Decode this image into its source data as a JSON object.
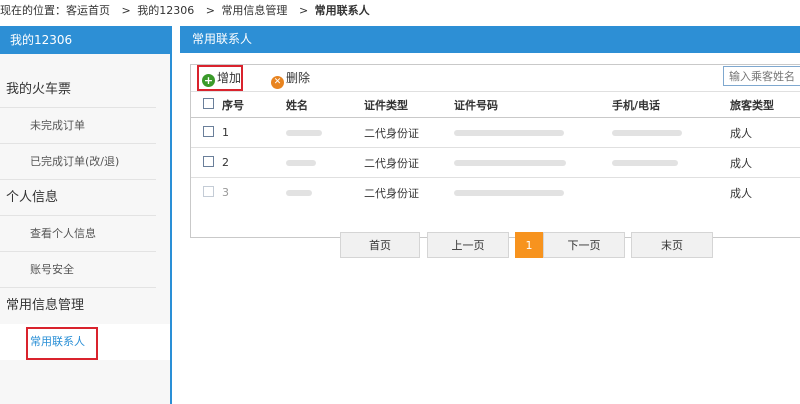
{
  "breadcrumb": {
    "prefix": "现在的位置：客运首页",
    "items": [
      "我的12306",
      "常用信息管理",
      "常用联系人"
    ],
    "sep": ">"
  },
  "sidebar": {
    "title": "我的12306",
    "groups": [
      {
        "label": "我的火车票",
        "items": [
          "未完成订单",
          "已完成订单(改/退)"
        ]
      },
      {
        "label": "个人信息",
        "items": [
          "查看个人信息",
          "账号安全"
        ]
      },
      {
        "label": "常用信息管理",
        "items": [
          "常用联系人"
        ]
      }
    ]
  },
  "panel": {
    "title": "常用联系人",
    "add_label": "增加",
    "delete_label": "删除",
    "search_placeholder": "输入乘客姓名"
  },
  "table": {
    "headers": [
      "序号",
      "姓名",
      "证件类型",
      "证件号码",
      "手机/电话",
      "旅客类型"
    ],
    "rows": [
      {
        "no": "1",
        "id_type": "二代身份证",
        "type": "成人"
      },
      {
        "no": "2",
        "id_type": "二代身份证",
        "type": "成人"
      },
      {
        "no": "3",
        "id_type": "二代身份证",
        "type": "成人"
      }
    ]
  },
  "pagination": {
    "first": "首页",
    "prev": "上一页",
    "current": "1",
    "next": "下一页",
    "last": "末页"
  },
  "colors": {
    "accent": "#2d8fd5",
    "highlight": "#d9232d",
    "page_active": "#f7931e"
  },
  "icons": {
    "add": "plus-circle-icon",
    "delete": "x-circle-icon"
  }
}
